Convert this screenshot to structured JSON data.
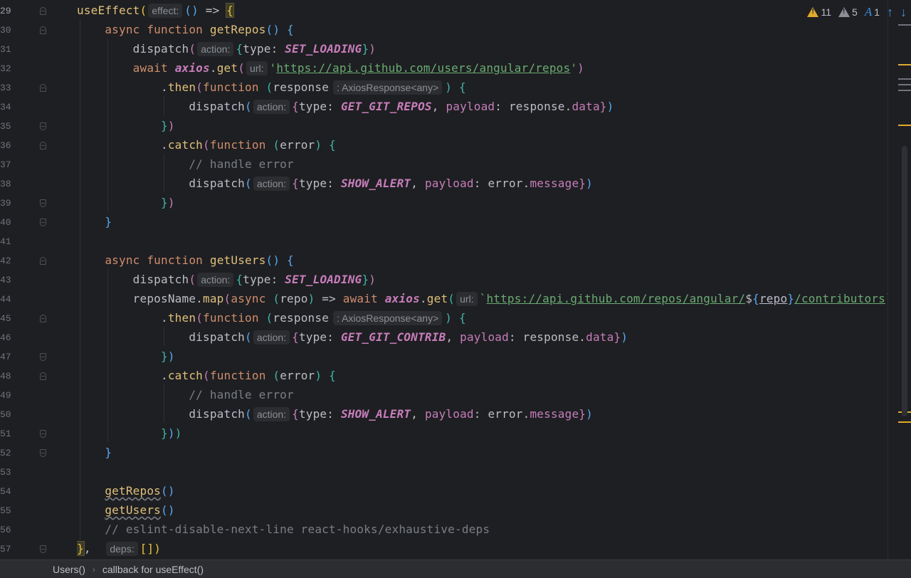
{
  "editor": {
    "line_numbers": [
      "29",
      "30",
      "31",
      "32",
      "33",
      "34",
      "35",
      "36",
      "37",
      "38",
      "39",
      "40",
      "41",
      "42",
      "43",
      "44",
      "45",
      "46",
      "47",
      "48",
      "49",
      "50",
      "51",
      "52",
      "53",
      "54",
      "55",
      "56",
      "57"
    ],
    "hints": {
      "effect": "effect:",
      "action": "action:",
      "url": "url:",
      "deps": "deps:",
      "response_type": ": AxiosResponse<any>"
    },
    "strings": {
      "repos_url": "https://api.github.com/users/angular/repos",
      "contrib_url_a": "https://api.github.com/repos/angular/",
      "contrib_url_var": "repo",
      "contrib_url_b": "/contributors"
    },
    "comments": {
      "handle_error": "// handle error",
      "eslint": "// eslint-disable-next-line react-hooks/exhaustive-deps"
    },
    "constants": {
      "set_loading": "SET_LOADING",
      "get_git_repos": "GET_GIT_REPOS",
      "show_alert": "SHOW_ALERT",
      "get_git_contrib": "GET_GIT_CONTRIB"
    },
    "identifiers": {
      "use_effect": "useEffect",
      "get_repos": "getRepos",
      "get_users": "getUsers",
      "dispatch": "dispatch",
      "axios": "axios",
      "get": "get",
      "then": "then",
      "catch": "catch",
      "response": "response",
      "error": "error",
      "repos_name": "reposName",
      "map": "map",
      "repo": "repo"
    }
  },
  "inspections": {
    "warnings": "11",
    "weak_warnings": "5",
    "typos": "1",
    "colors": {
      "warning": "#e0a92c",
      "weak": "#8c8f96",
      "typo": "#3d8fe0"
    }
  },
  "statusbar": {
    "crumb_1": "Users()",
    "crumb_2": "callback for useEffect()"
  }
}
